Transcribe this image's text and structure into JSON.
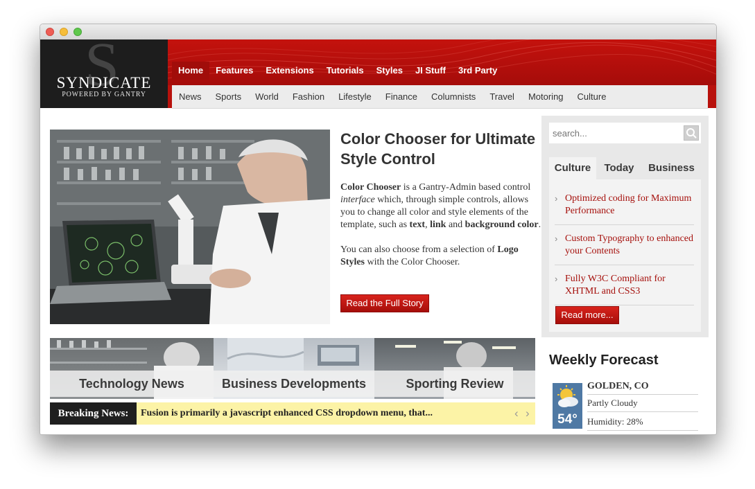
{
  "site": {
    "logo_name": "SYNDICATE",
    "logo_sub": "POWERED BY GANTRY"
  },
  "main_nav": [
    "Home",
    "Features",
    "Extensions",
    "Tutorials",
    "Styles",
    "JI Stuff",
    "3rd Party"
  ],
  "sub_nav": [
    "News",
    "Sports",
    "World",
    "Fashion",
    "Lifestyle",
    "Finance",
    "Columnists",
    "Travel",
    "Motoring",
    "Culture"
  ],
  "feature": {
    "title": "Color Chooser for Ultimate Style Control",
    "p1_bold": "Color Chooser",
    "p1_a": " is a Gantry-Admin based control ",
    "p1_em": "interface",
    "p1_b": " which, through simple controls, allows you to change all color and style elements of the template, such as ",
    "p1_bold2": "text",
    "p1_comma": ", ",
    "p1_bold3": "link",
    "p1_and": " and ",
    "p1_bold4": "background color",
    "p1_end": ".",
    "p2_a": "You can also choose from a selection of ",
    "p2_bold": "Logo Styles",
    "p2_b": " with the Color Chooser.",
    "button": "Read the Full Story"
  },
  "showcase": [
    "Technology News",
    "Business Developments",
    "Sporting Review"
  ],
  "breaking": {
    "label": "Breaking News:",
    "text": "Fusion is primarily a javascript enhanced CSS dropdown menu, that...",
    "prev": "‹",
    "next": "›"
  },
  "sidebar": {
    "search_placeholder": "search...",
    "tabs": [
      "Culture",
      "Today",
      "Business"
    ],
    "items": [
      "Optimized coding for Maximum Performance",
      "Custom Typography to enhanced your Contents",
      "Fully W3C Compliant for XHTML and CSS3"
    ],
    "read_more": "Read more..."
  },
  "weather": {
    "title": "Weekly Forecast",
    "location": "GOLDEN, CO",
    "condition": "Partly Cloudy",
    "humidity": "Humidity: 28%",
    "temp": "54°",
    "icon": "partly-cloudy-icon"
  },
  "colors": {
    "brand_red": "#b8110c",
    "link_red": "#a50f0b",
    "breaking_bg": "#fcf3a6",
    "weather_blue": "#4f79a4"
  }
}
